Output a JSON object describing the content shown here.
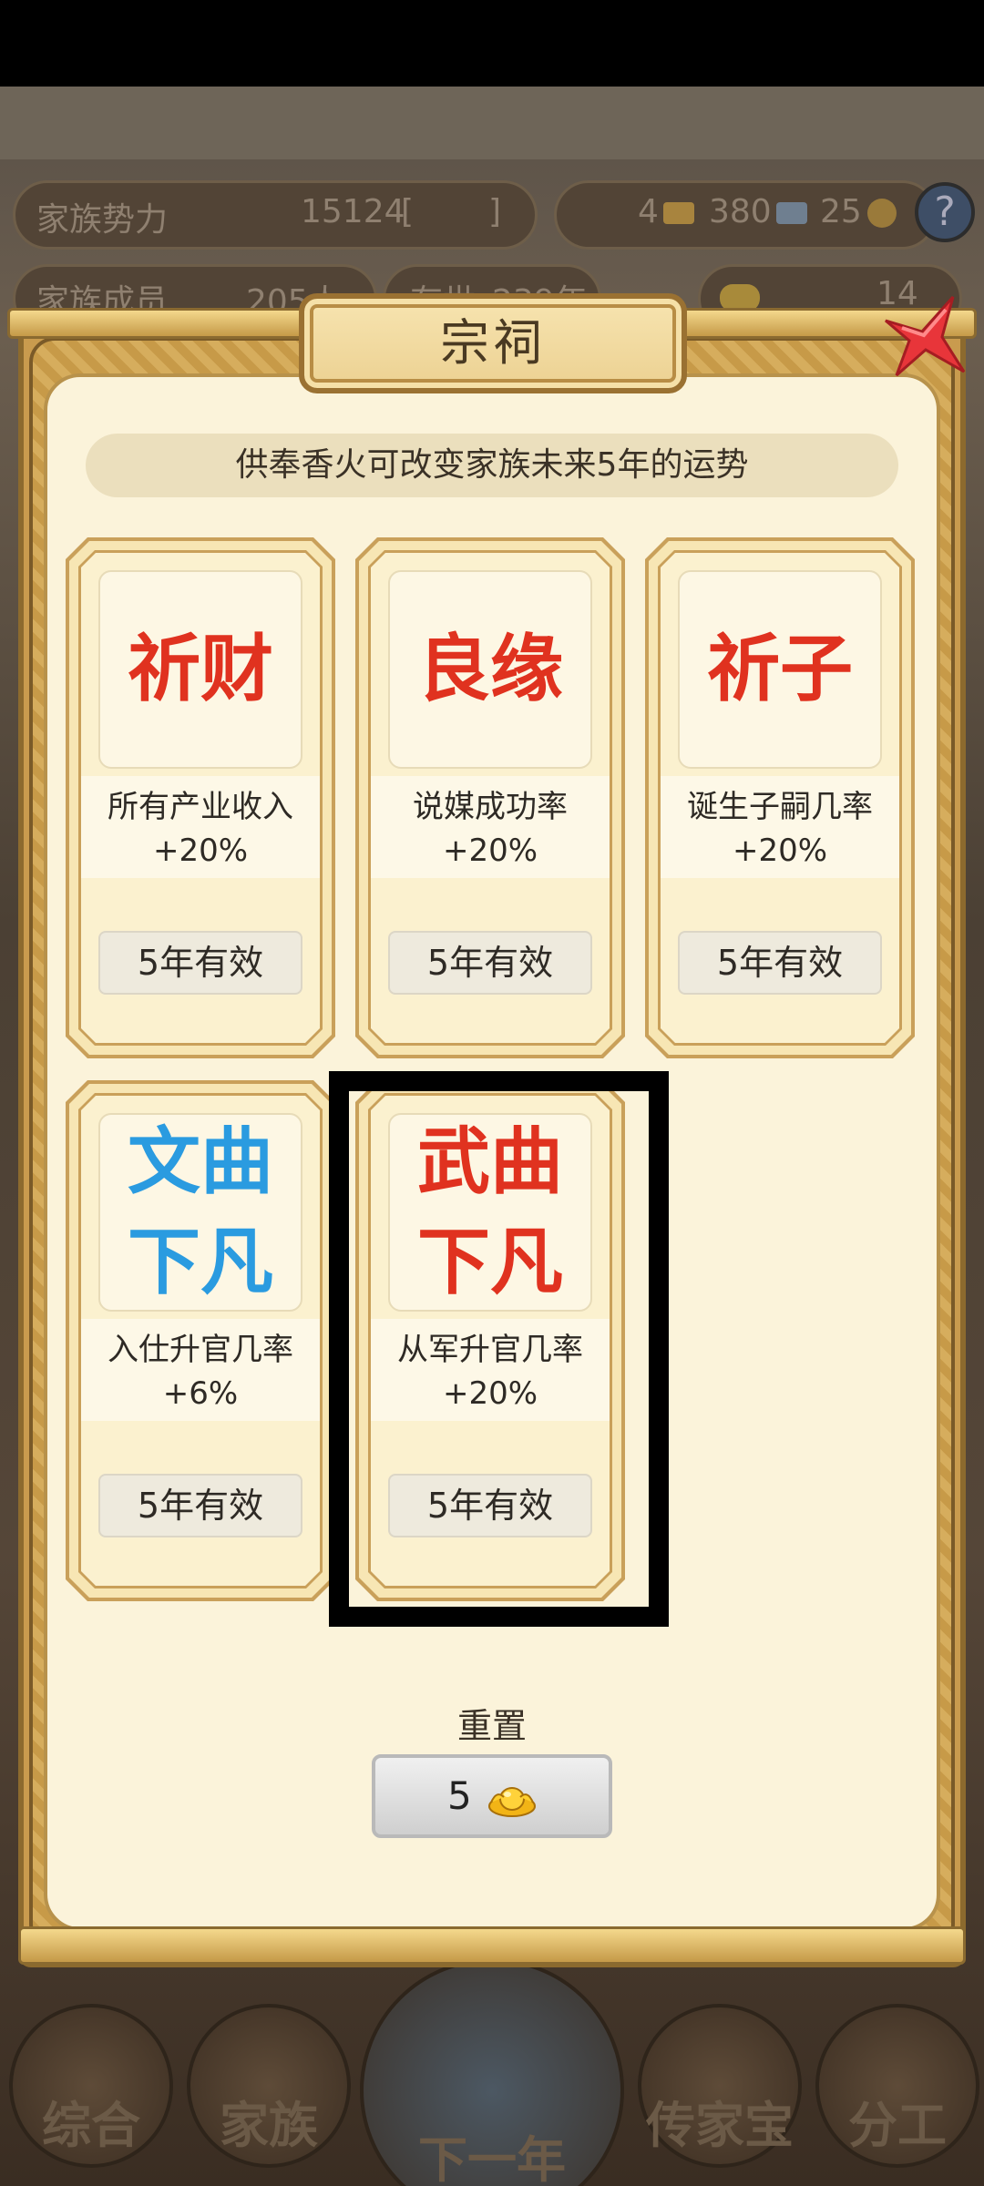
{
  "header": {
    "stat1_label": "家族势力",
    "stat1_value": "15124",
    "stat1_bracket_open": "[",
    "stat1_bracket_close": "]",
    "stat2_label": "家族成员",
    "stat2_value": "205人",
    "stat3_label": "存世",
    "stat3_value": "239年",
    "res_gold": "4",
    "res_silver": "380",
    "res_coins": "25",
    "res_ingot": "14",
    "help_icon": "?"
  },
  "dialog": {
    "title": "宗祠",
    "subtitle": "供奉香火可改变家族未来5年的运势",
    "cards": [
      {
        "name": "祈财",
        "desc": "所有产业收入+20%",
        "duration": "5年有效",
        "color": "#e0321f"
      },
      {
        "name": "良缘",
        "desc": "说媒成功率+20%",
        "duration": "5年有效",
        "color": "#e0321f"
      },
      {
        "name": "祈子",
        "desc": "诞生子嗣几率+20%",
        "duration": "5年有效",
        "color": "#e0321f"
      },
      {
        "name": "文曲下凡",
        "desc": "入仕升官几率+6%",
        "duration": "5年有效",
        "color": "#2a9be0"
      },
      {
        "name": "武曲下凡",
        "desc": "从军升官几率+20%",
        "duration": "5年有效",
        "color": "#e0321f"
      }
    ],
    "reset_label": "重置",
    "reset_cost": "5"
  },
  "nav": {
    "items": [
      {
        "label": "综合"
      },
      {
        "label": "家族"
      },
      {
        "label": "下一年"
      },
      {
        "label": "传家宝"
      },
      {
        "label": "分工"
      }
    ]
  }
}
